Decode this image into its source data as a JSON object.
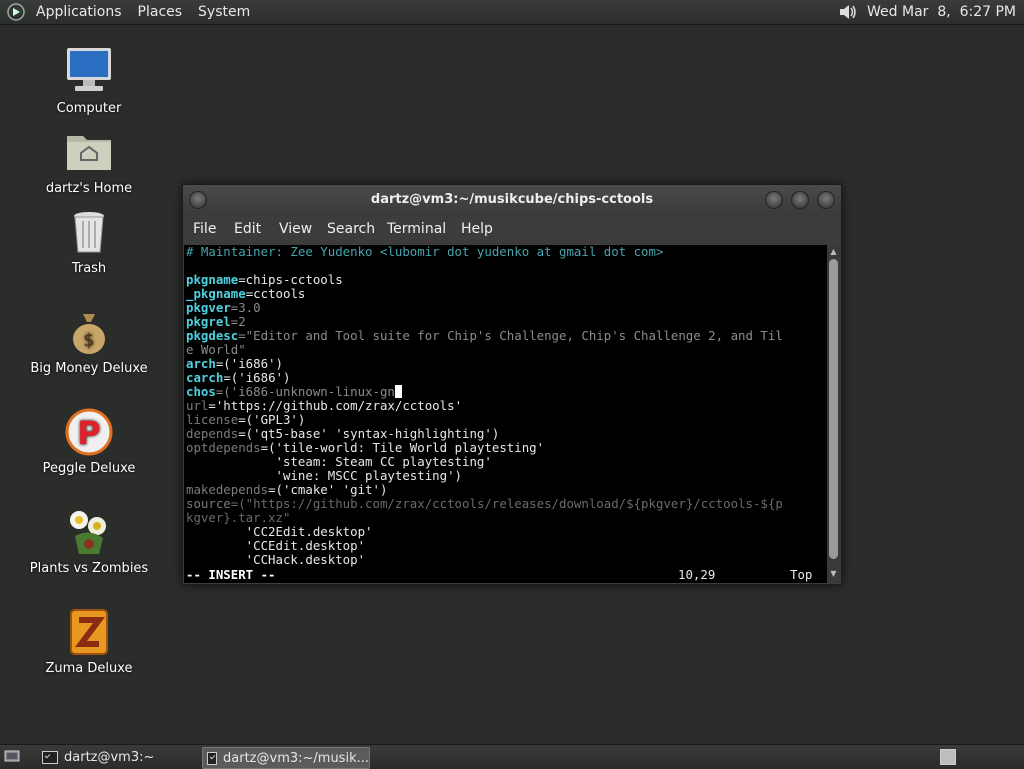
{
  "top_panel": {
    "menus": [
      "Applications",
      "Places",
      "System"
    ],
    "clock": "Wed Mar  8,  6:27 PM"
  },
  "desktop_icons": [
    {
      "label": "Computer",
      "icon": "computer-icon"
    },
    {
      "label": "dartz's Home",
      "icon": "home-folder-icon"
    },
    {
      "label": "Trash",
      "icon": "trash-icon"
    },
    {
      "label": "Big Money Deluxe",
      "icon": "money-bag-icon"
    },
    {
      "label": "Peggle Deluxe",
      "icon": "peggle-icon"
    },
    {
      "label": "Plants vs Zombies",
      "icon": "plants-vs-zombies-icon"
    },
    {
      "label": "Zuma Deluxe",
      "icon": "zuma-icon"
    }
  ],
  "terminal": {
    "title": "dartz@vm3:~/musikcube/chips-cctools",
    "menu": [
      "File",
      "Edit",
      "View",
      "Search",
      "Terminal",
      "Help"
    ],
    "lines": {
      "l01": "# Maintainer: Zee Yudenko <lubomir dot yudenko at gmail dot com>",
      "l03k": "pkgname",
      "l03v": "=chips-cctools",
      "l04k": "_pkgname",
      "l04v": "=cctools",
      "l05k": "pkgver",
      "l05v": "=3.0",
      "l06k": "pkgrel",
      "l06v": "=2",
      "l07k": "pkgdesc",
      "l07v": "=\"Editor and Tool suite for Chip's Challenge, Chip's Challenge 2, and Til",
      "l08": "e World\"",
      "l09k": "arch",
      "l09v": "=('i686')",
      "l10k": "carch",
      "l10v": "=('i686')",
      "l11k": "chos",
      "l11v": "=('i686-unknown-linux-gn",
      "l12a": "url",
      "l12b": "='https://github.com/zrax/cctools'",
      "l13a": "license",
      "l13b": "=('GPL3')",
      "l14a": "depends",
      "l14b": "=('qt5-base' 'syntax-highlighting')",
      "l15a": "optdepends",
      "l15b": "=('tile-world: Tile World playtesting'",
      "l16": "            'steam: Steam CC playtesting'",
      "l17": "            'wine: MSCC playtesting')",
      "l18a": "makedepends",
      "l18b": "=('cmake' 'git')",
      "l19a": "source",
      "l19b": "=(\"https://github.com/zrax/cctools/releases/download/${pkgver}/cctools-${p",
      "l20": "kgver}.tar.xz\"",
      "l21": "        'CC2Edit.desktop'",
      "l22": "        'CCEdit.desktop'",
      "l23": "        'CCHack.desktop'"
    },
    "status": {
      "mode": "-- INSERT --",
      "position": "10,29",
      "scroll": "Top"
    }
  },
  "taskbar": {
    "tasks": [
      "dartz@vm3:~",
      "dartz@vm3:~/musik..."
    ]
  }
}
